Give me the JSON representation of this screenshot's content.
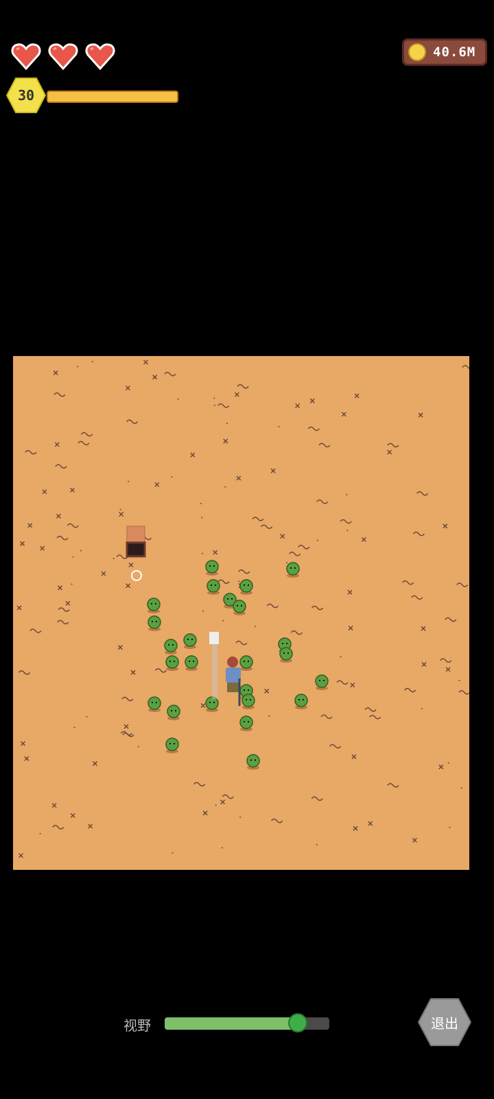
{
  "hud": {
    "hearts_count": 3,
    "coins": "40.6M",
    "level": "30",
    "xp_fraction": 1.0
  },
  "colors": {
    "heart": "#e8574a",
    "coin_box": "#8a4a3c",
    "level_badge": "#f2e14a",
    "xp": "#f0b03a",
    "ground": "#e8a866",
    "slime": "#5aa040",
    "slider_fill": "#7fbf6a"
  },
  "bottom": {
    "view_label": "视野",
    "view_level": 0.81,
    "exit_label": "退出"
  }
}
